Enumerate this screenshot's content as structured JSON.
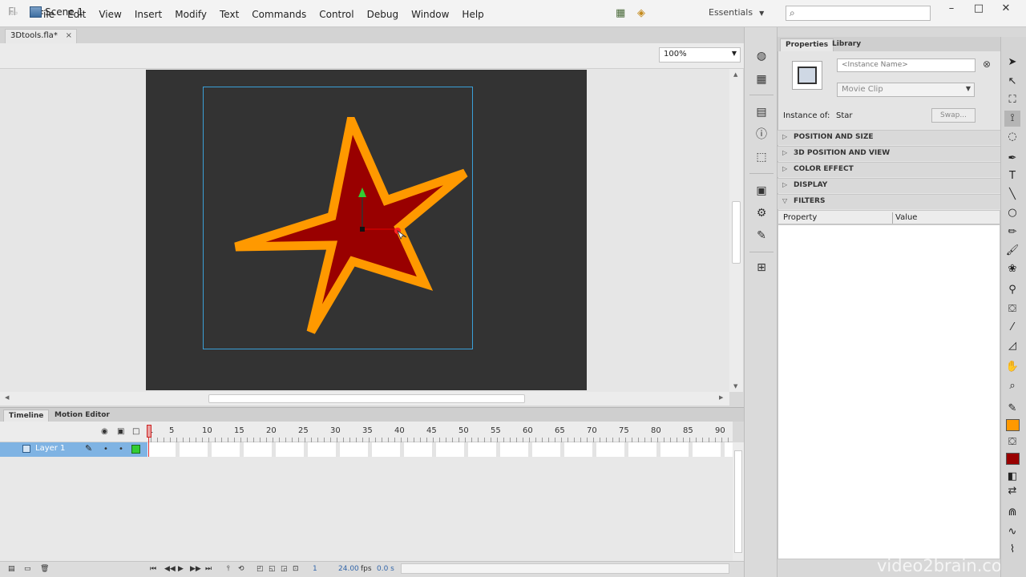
{
  "app": {
    "logo": "Fl",
    "menus": [
      "File",
      "Edit",
      "View",
      "Insert",
      "Modify",
      "Text",
      "Commands",
      "Control",
      "Debug",
      "Window",
      "Help"
    ],
    "workspace": "Essentials",
    "window_controls": [
      "–",
      "□",
      "✕"
    ]
  },
  "document": {
    "tab_label": "3Dtools.fla*",
    "tab_close": "×",
    "scene_label": "Scene 1",
    "zoom": "100%"
  },
  "stage": {
    "stage_color": "#333333",
    "star_fill": "#990000",
    "star_stroke": "#ff9900"
  },
  "timeline": {
    "tab_timeline": "Timeline",
    "tab_motion": "Motion Editor",
    "layer_name": "Layer 1",
    "frame_numbers": [
      "1",
      "5",
      "10",
      "15",
      "20",
      "25",
      "30",
      "35",
      "40",
      "45",
      "50",
      "55",
      "60",
      "65",
      "70",
      "75",
      "80",
      "85",
      "90"
    ],
    "current_frame": "1",
    "fps": "24.00",
    "fps_unit": "fps",
    "time": "0.0 s"
  },
  "properties": {
    "tab_properties": "Properties",
    "tab_library": "Library",
    "instance_name_placeholder": "<Instance Name>",
    "symbol_type": "Movie Clip",
    "instance_of_label": "Instance of:",
    "instance_of_value": "Star",
    "swap_label": "Swap...",
    "sections": [
      "POSITION AND SIZE",
      "3D POSITION AND VIEW",
      "COLOR EFFECT",
      "DISPLAY",
      "FILTERS"
    ],
    "filter_columns": [
      "Property",
      "Value"
    ]
  },
  "tools": {
    "stroke_color": "#ff9900",
    "fill_color": "#990000"
  },
  "watermark": "video2brain.com"
}
